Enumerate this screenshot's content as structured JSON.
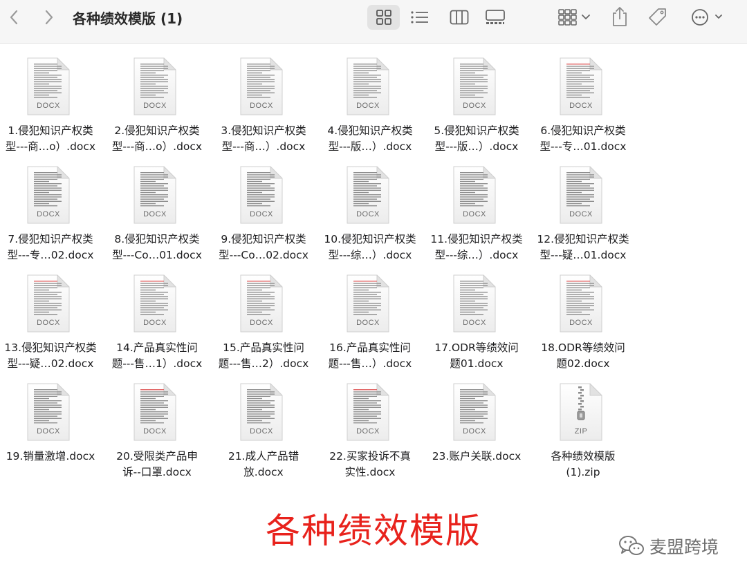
{
  "window": {
    "title": "各种绩效模版 (1)"
  },
  "toolbar": {
    "back_icon": "chevron-left-icon",
    "forward_icon": "chevron-right-icon",
    "view_icons": [
      "grid-view-icon",
      "list-view-icon",
      "column-view-icon",
      "gallery-view-icon"
    ],
    "active_view": "grid-view-icon",
    "group_icon": "group-by-icon",
    "share_icon": "share-icon",
    "tag_icon": "tag-icon",
    "more_icon": "ellipsis-circle-icon"
  },
  "files": [
    {
      "line1": "1.侵犯知识产权类",
      "line2": "型---商…o）.docx",
      "type": "DOCX",
      "redmark": false
    },
    {
      "line1": "2.侵犯知识产权类",
      "line2": "型---商…o）.docx",
      "type": "DOCX",
      "redmark": false
    },
    {
      "line1": "3.侵犯知识产权类",
      "line2": "型---商…）.docx",
      "type": "DOCX",
      "redmark": false
    },
    {
      "line1": "4.侵犯知识产权类",
      "line2": "型---版…）.docx",
      "type": "DOCX",
      "redmark": false
    },
    {
      "line1": "5.侵犯知识产权类",
      "line2": "型---版…）.docx",
      "type": "DOCX",
      "redmark": false
    },
    {
      "line1": "6.侵犯知识产权类",
      "line2": "型---专…01.docx",
      "type": "DOCX",
      "redmark": true
    },
    {
      "line1": "7.侵犯知识产权类",
      "line2": "型---专…02.docx",
      "type": "DOCX",
      "redmark": false
    },
    {
      "line1": "8.侵犯知识产权类",
      "line2": "型---Co…01.docx",
      "type": "DOCX",
      "redmark": false
    },
    {
      "line1": "9.侵犯知识产权类",
      "line2": "型---Co…02.docx",
      "type": "DOCX",
      "redmark": false
    },
    {
      "line1": "10.侵犯知识产权类",
      "line2": "型---综…）.docx",
      "type": "DOCX",
      "redmark": false
    },
    {
      "line1": "11.侵犯知识产权类",
      "line2": "型---综…）.docx",
      "type": "DOCX",
      "redmark": false
    },
    {
      "line1": "12.侵犯知识产权类",
      "line2": "型---疑…01.docx",
      "type": "DOCX",
      "redmark": false
    },
    {
      "line1": "13.侵犯知识产权类",
      "line2": "型---疑…02.docx",
      "type": "DOCX",
      "redmark": true
    },
    {
      "line1": "14.产品真实性问",
      "line2": "题---售…1）.docx",
      "type": "DOCX",
      "redmark": true
    },
    {
      "line1": "15.产品真实性问",
      "line2": "题---售…2）.docx",
      "type": "DOCX",
      "redmark": true
    },
    {
      "line1": "16.产品真实性问",
      "line2": "题---售…）.docx",
      "type": "DOCX",
      "redmark": true
    },
    {
      "line1": "17.ODR等绩效问",
      "line2": "题01.docx",
      "type": "DOCX",
      "redmark": false
    },
    {
      "line1": "18.ODR等绩效问",
      "line2": "题02.docx",
      "type": "DOCX",
      "redmark": true
    },
    {
      "line1": "19.销量激增.docx",
      "line2": "",
      "type": "DOCX",
      "redmark": false
    },
    {
      "line1": "20.受限类产品申",
      "line2": "诉--口罩.docx",
      "type": "DOCX",
      "redmark": true
    },
    {
      "line1": "21.成人产品错",
      "line2": "放.docx",
      "type": "DOCX",
      "redmark": false
    },
    {
      "line1": "22.买家投诉不真",
      "line2": "实性.docx",
      "type": "DOCX",
      "redmark": true
    },
    {
      "line1": "23.账户关联.docx",
      "line2": "",
      "type": "DOCX",
      "redmark": false
    },
    {
      "line1": "各种绩效模版",
      "line2": "(1).zip",
      "type": "ZIP",
      "redmark": false
    }
  ],
  "banner": {
    "text": "各种绩效模版"
  },
  "watermark": {
    "text": "麦盟跨境",
    "icon": "wechat-icon"
  },
  "colors": {
    "banner": "#e8221c",
    "toolbar_bg": "#f6f6f6",
    "icon_grey": "#7a7a7a"
  }
}
